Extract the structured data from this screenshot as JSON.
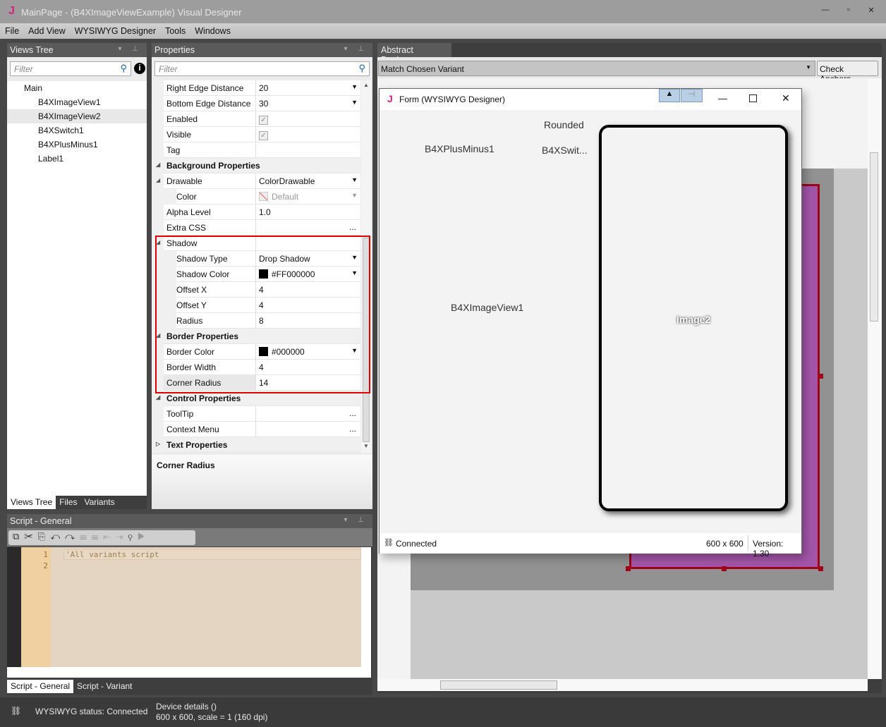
{
  "window": {
    "title": "MainPage - (B4XImageViewExample) Visual Designer",
    "logo": "J"
  },
  "menu": [
    "File",
    "Add View",
    "WYSIWYG Designer",
    "Tools",
    "Windows"
  ],
  "views_tree": {
    "title": "Views Tree",
    "filter_placeholder": "Filter",
    "items": [
      {
        "label": "Main",
        "level": 0
      },
      {
        "label": "B4XImageView1",
        "level": 1
      },
      {
        "label": "B4XImageView2",
        "level": 1,
        "selected": true
      },
      {
        "label": "B4XSwitch1",
        "level": 1
      },
      {
        "label": "B4XPlusMinus1",
        "level": 1
      },
      {
        "label": "Label1",
        "level": 1
      }
    ],
    "tabs": [
      "Views Tree",
      "Files",
      "Variants"
    ]
  },
  "properties": {
    "title": "Properties",
    "filter_placeholder": "Filter",
    "rows": [
      {
        "name": "Right Edge Distance",
        "value": "20",
        "type": "dropdown",
        "level": 1
      },
      {
        "name": "Bottom Edge Distance",
        "value": "30",
        "type": "dropdown",
        "level": 1
      },
      {
        "name": "Enabled",
        "value": "✓",
        "type": "check",
        "level": 1
      },
      {
        "name": "Visible",
        "value": "✓",
        "type": "check",
        "level": 1
      },
      {
        "name": "Tag",
        "value": "",
        "type": "text",
        "level": 1
      },
      {
        "name": "Background Properties",
        "type": "category",
        "expanded": true
      },
      {
        "name": "Drawable",
        "value": "ColorDrawable",
        "type": "dropdown",
        "level": 1,
        "expandable": true
      },
      {
        "name": "Color",
        "value": "Default",
        "type": "color-default",
        "level": 2
      },
      {
        "name": "Alpha Level",
        "value": "1.0",
        "type": "text",
        "level": 1
      },
      {
        "name": "Extra CSS",
        "value": "...",
        "type": "ellipsis",
        "level": 1
      },
      {
        "name": "Shadow",
        "value": "",
        "type": "text",
        "level": 1,
        "expandable": true
      },
      {
        "name": "Shadow Type",
        "value": "Drop Shadow",
        "type": "dropdown",
        "level": 2
      },
      {
        "name": "Shadow Color",
        "value": "#FF000000",
        "type": "color",
        "level": 2
      },
      {
        "name": "Offset X",
        "value": "4",
        "type": "text",
        "level": 2
      },
      {
        "name": "Offset Y",
        "value": "4",
        "type": "text",
        "level": 2
      },
      {
        "name": "Radius",
        "value": "8",
        "type": "text",
        "level": 2
      },
      {
        "name": "Border Properties",
        "type": "category",
        "expanded": true
      },
      {
        "name": "Border Color",
        "value": "#000000",
        "type": "color",
        "level": 1
      },
      {
        "name": "Border Width",
        "value": "4",
        "type": "text",
        "level": 1
      },
      {
        "name": "Corner Radius",
        "value": "14",
        "type": "text",
        "level": 1,
        "selected": true
      },
      {
        "name": "Control Properties",
        "type": "category",
        "expanded": true
      },
      {
        "name": "ToolTip",
        "value": "...",
        "type": "ellipsis",
        "level": 1
      },
      {
        "name": "Context Menu",
        "value": "...",
        "type": "ellipsis",
        "level": 1
      },
      {
        "name": "Text Properties",
        "type": "category",
        "expanded": false
      }
    ],
    "description": "Corner Radius",
    "highlight_color": "#e00000"
  },
  "script": {
    "title": "Script - General",
    "lines": [
      "1",
      "2"
    ],
    "code": "'All variants script",
    "tabs": [
      "Script - General",
      "Script - Variant"
    ]
  },
  "designer": {
    "tab": "Abstract Designer",
    "variant": "Match Chosen Variant",
    "check_anchors": "Check Anchors",
    "accent": "#a0001a",
    "fill": "#a355a8"
  },
  "form": {
    "title": "Form (WYSIWYG Designer)",
    "logo": "J",
    "labels": {
      "rounded": "Rounded",
      "plusminus": "B4XPlusMinus1",
      "switch": "B4XSwit...",
      "imageview1": "B4XImageView1",
      "image2": "image2"
    },
    "status": "Connected",
    "size": "600 x 600",
    "version": "Version: 1.30"
  },
  "statusbar": {
    "wysiwyg": "WYSIWYG status: Connected",
    "device_title": "Device details ()",
    "device_info": "600 x 600, scale = 1 (160 dpi)"
  }
}
